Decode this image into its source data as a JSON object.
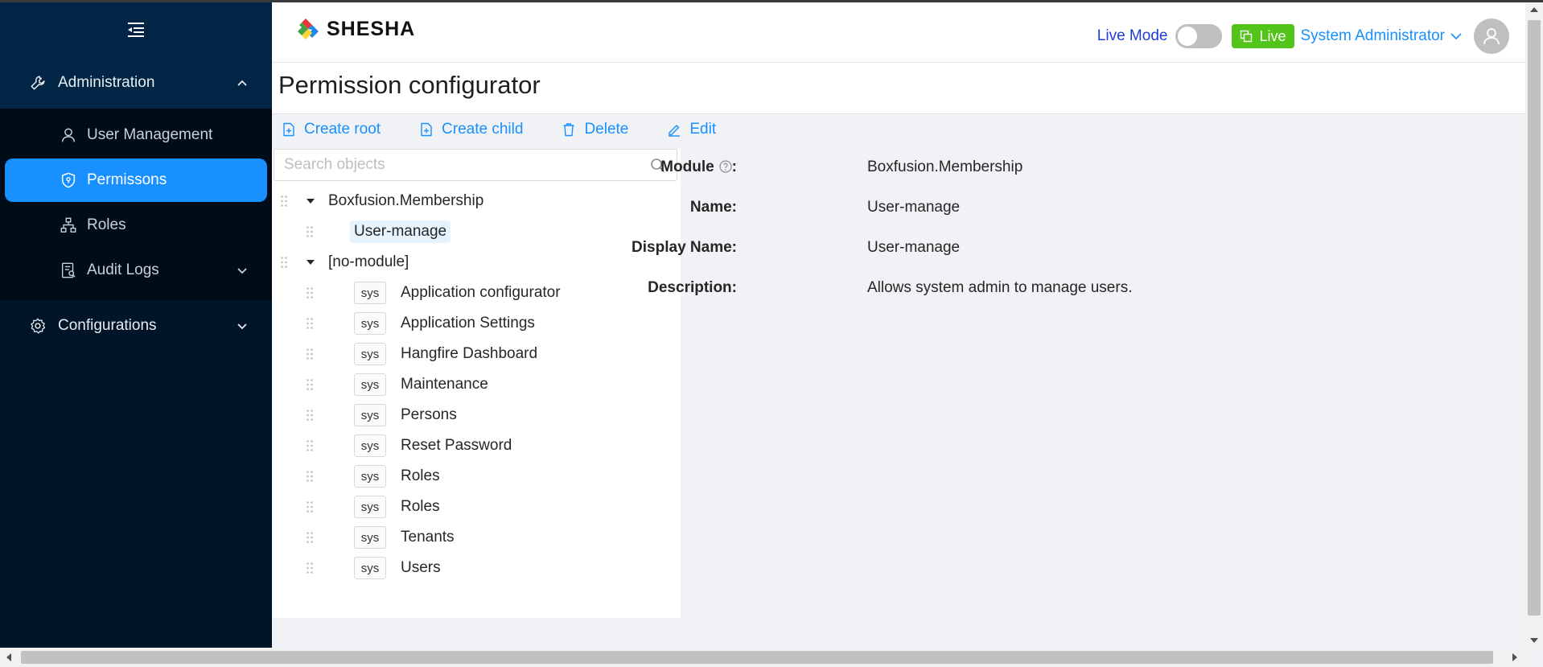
{
  "app": {
    "logo_text": "SHESHA",
    "brand_colors": [
      "#e53935",
      "#43a047",
      "#1e88e5",
      "#fdd835"
    ]
  },
  "sidebar": {
    "groups": [
      {
        "label": "Administration",
        "icon": "wrench-icon",
        "expanded": true,
        "items": [
          {
            "label": "User Management",
            "icon": "user-icon"
          },
          {
            "label": "Permissons",
            "icon": "shield-icon",
            "active": true
          },
          {
            "label": "Roles",
            "icon": "sitemap-icon"
          },
          {
            "label": "Audit Logs",
            "icon": "audit-icon",
            "has_children": true
          }
        ]
      },
      {
        "label": "Configurations",
        "icon": "gear-icon",
        "expanded": false
      }
    ]
  },
  "header": {
    "live_mode_label": "Live Mode",
    "live_mode_on": false,
    "live_button": "Live",
    "user_name": "System Administrator"
  },
  "page": {
    "title": "Permission configurator"
  },
  "toolbar": {
    "create_root": "Create root",
    "create_child": "Create child",
    "delete": "Delete",
    "edit": "Edit"
  },
  "search": {
    "placeholder": "Search objects"
  },
  "tree": {
    "modules": [
      {
        "label": "Boxfusion.Membership",
        "children": [
          {
            "label": "User-manage",
            "selected": true
          }
        ]
      },
      {
        "label": "[no-module]",
        "children": [
          {
            "tag": "sys",
            "label": "Application configurator"
          },
          {
            "tag": "sys",
            "label": "Application Settings"
          },
          {
            "tag": "sys",
            "label": "Hangfire Dashboard"
          },
          {
            "tag": "sys",
            "label": "Maintenance"
          },
          {
            "tag": "sys",
            "label": "Persons"
          },
          {
            "tag": "sys",
            "label": "Reset Password"
          },
          {
            "tag": "sys",
            "label": "Roles"
          },
          {
            "tag": "sys",
            "label": "Roles"
          },
          {
            "tag": "sys",
            "label": "Tenants"
          },
          {
            "tag": "sys",
            "label": "Users"
          }
        ]
      }
    ]
  },
  "details": {
    "fields": [
      {
        "label": "Module",
        "value": "Boxfusion.Membership",
        "help": true
      },
      {
        "label": "Name",
        "value": "User-manage"
      },
      {
        "label": "Display Name",
        "value": "User-manage"
      },
      {
        "label": "Description",
        "value": "Allows system admin to manage users."
      }
    ]
  }
}
